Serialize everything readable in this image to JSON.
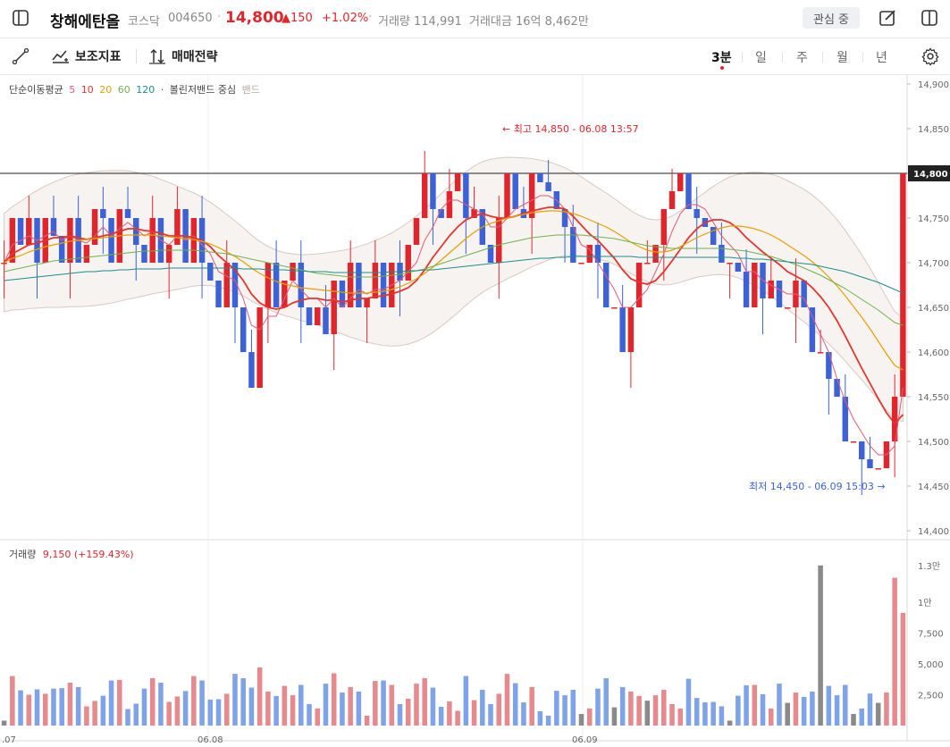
{
  "header": {
    "stock_name": "창해에탄올",
    "market": "코스닥",
    "code": "004650",
    "separator": "·",
    "price": "14,800",
    "change": "▲150",
    "change_pct": "+1.02%",
    "volume_label": "거래량 114,991",
    "amount_label": "거래대금 16억 8,462만",
    "watch_button": "관심 중"
  },
  "toolbar": {
    "indicators_label": "보조지표",
    "strategy_label": "매매전략",
    "periods": [
      "3분",
      "일",
      "주",
      "월",
      "년"
    ],
    "active_period": "3분"
  },
  "legend": {
    "ma_title": "단순이동평균",
    "ma_periods": [
      "5",
      "10",
      "20",
      "60",
      "120"
    ],
    "bullet": "·",
    "bb_title": "볼린저밴드 중심",
    "bb_band": "밴드"
  },
  "colors": {
    "up": "#e0262d",
    "down": "#3c62d6",
    "ma5": "#e35b7a",
    "ma10": "#e5342d",
    "ma20": "#e6a100",
    "ma60": "#6fb24f",
    "ma120": "#1a8f8a"
  },
  "chart_data": {
    "type": "candlestick",
    "price_axis": [
      "14,900",
      "14,850",
      "14,800",
      "14,750",
      "14,700",
      "14,650",
      "14,600",
      "14,550",
      "14,500",
      "14,450",
      "14,400"
    ],
    "current_price_tag": "14,800",
    "high_annotation": "최고 14,850 - 06.08 13:57",
    "low_annotation": "최저 14,450 - 06.09 15:03",
    "x_axis_labels": [
      ".07",
      "06.08",
      "06.09"
    ],
    "ylim": [
      14400,
      14900
    ],
    "candles_close": [
      14700,
      14750,
      14720,
      14750,
      14700,
      14750,
      14730,
      14700,
      14750,
      14700,
      14720,
      14760,
      14750,
      14700,
      14760,
      14750,
      14720,
      14700,
      14750,
      14700,
      14720,
      14760,
      14700,
      14750,
      14700,
      14680,
      14650,
      14700,
      14650,
      14600,
      14560,
      14650,
      14700,
      14650,
      14680,
      14700,
      14650,
      14630,
      14650,
      14620,
      14680,
      14650,
      14700,
      14650,
      14660,
      14700,
      14650,
      14700,
      14680,
      14720,
      14750,
      14800,
      14760,
      14750,
      14780,
      14800,
      14750,
      14760,
      14720,
      14700,
      14750,
      14800,
      14760,
      14750,
      14800,
      14790,
      14780,
      14760,
      14740,
      14700,
      14700,
      14720,
      14700,
      14650,
      14650,
      14600,
      14650,
      14700,
      14700,
      14720,
      14760,
      14780,
      14800,
      14760,
      14750,
      14740,
      14720,
      14700,
      14700,
      14690,
      14650,
      14700,
      14660,
      14680,
      14650,
      14650,
      14680,
      14650,
      14600,
      14600,
      14570,
      14550,
      14500,
      14500,
      14480,
      14470,
      14470,
      14500,
      14550,
      14800
    ],
    "ma_series": [
      {
        "name": "5",
        "values": [
          14700,
          14720,
          14725,
          14730,
          14725,
          14730,
          14735,
          14725,
          14730,
          14725,
          14722,
          14730,
          14740,
          14730,
          14738,
          14745,
          14738,
          14730,
          14735,
          14725,
          14720,
          14730,
          14725,
          14730,
          14720,
          14710,
          14690,
          14685,
          14680,
          14660,
          14630,
          14625,
          14640,
          14640,
          14660,
          14680,
          14670,
          14660,
          14660,
          14650,
          14660,
          14650,
          14660,
          14670,
          14665,
          14670,
          14670,
          14675,
          14680,
          14690,
          14700,
          14725,
          14740,
          14760,
          14770,
          14770,
          14765,
          14760,
          14755,
          14740,
          14740,
          14750,
          14760,
          14765,
          14770,
          14775,
          14775,
          14770,
          14760,
          14740,
          14720,
          14715,
          14700,
          14685,
          14670,
          14650,
          14650,
          14660,
          14670,
          14690,
          14710,
          14735,
          14755,
          14765,
          14765,
          14760,
          14745,
          14730,
          14720,
          14710,
          14690,
          14690,
          14680,
          14675,
          14670,
          14665,
          14665,
          14660,
          14640,
          14620,
          14600,
          14570,
          14545,
          14525,
          14510,
          14495,
          14485,
          14485,
          14495,
          14560
        ]
      },
      {
        "name": "10",
        "values": [
          14700,
          14710,
          14715,
          14720,
          14722,
          14725,
          14728,
          14728,
          14730,
          14728,
          14726,
          14728,
          14730,
          14732,
          14735,
          14738,
          14738,
          14736,
          14735,
          14733,
          14730,
          14730,
          14730,
          14728,
          14725,
          14718,
          14708,
          14700,
          14692,
          14680,
          14665,
          14655,
          14650,
          14648,
          14650,
          14655,
          14658,
          14660,
          14660,
          14658,
          14658,
          14656,
          14658,
          14660,
          14660,
          14662,
          14663,
          14665,
          14668,
          14672,
          14680,
          14692,
          14706,
          14718,
          14730,
          14740,
          14748,
          14752,
          14755,
          14752,
          14750,
          14750,
          14752,
          14755,
          14758,
          14760,
          14762,
          14762,
          14760,
          14752,
          14742,
          14732,
          14725,
          14715,
          14705,
          14692,
          14682,
          14678,
          14676,
          14680,
          14690,
          14702,
          14715,
          14728,
          14738,
          14745,
          14748,
          14748,
          14745,
          14738,
          14728,
          14720,
          14712,
          14705,
          14698,
          14690,
          14685,
          14680,
          14672,
          14662,
          14650,
          14635,
          14618,
          14600,
          14582,
          14565,
          14548,
          14532,
          14520,
          14530
        ]
      },
      {
        "name": "20",
        "values": [
          14700,
          14705,
          14708,
          14712,
          14715,
          14718,
          14720,
          14722,
          14724,
          14725,
          14726,
          14727,
          14728,
          14729,
          14730,
          14731,
          14731,
          14731,
          14731,
          14730,
          14729,
          14728,
          14727,
          14726,
          14724,
          14721,
          14717,
          14712,
          14707,
          14701,
          14694,
          14688,
          14683,
          14679,
          14676,
          14674,
          14672,
          14671,
          14670,
          14669,
          14668,
          14667,
          14666,
          14666,
          14666,
          14667,
          14668,
          14670,
          14673,
          14677,
          14682,
          14688,
          14695,
          14703,
          14711,
          14719,
          14727,
          14734,
          14740,
          14744,
          14747,
          14750,
          14752,
          14754,
          14756,
          14757,
          14758,
          14758,
          14757,
          14755,
          14752,
          14748,
          14744,
          14740,
          14735,
          14729,
          14723,
          14718,
          14714,
          14712,
          14712,
          14714,
          14718,
          14723,
          14728,
          14732,
          14736,
          14739,
          14741,
          14741,
          14740,
          14738,
          14735,
          14731,
          14726,
          14720,
          14714,
          14708,
          14701,
          14693,
          14684,
          14674,
          14663,
          14651,
          14639,
          14626,
          14612,
          14598,
          14585,
          14580
        ]
      },
      {
        "name": "60",
        "values": [
          14690,
          14692,
          14694,
          14696,
          14698,
          14700,
          14702,
          14703,
          14704,
          14705,
          14706,
          14707,
          14708,
          14709,
          14710,
          14711,
          14712,
          14713,
          14713,
          14714,
          14714,
          14714,
          14714,
          14714,
          14713,
          14712,
          14711,
          14710,
          14708,
          14706,
          14704,
          14702,
          14700,
          14698,
          14696,
          14694,
          14692,
          14690,
          14688,
          14687,
          14686,
          14685,
          14684,
          14684,
          14684,
          14684,
          14685,
          14686,
          14687,
          14689,
          14691,
          14693,
          14696,
          14699,
          14702,
          14705,
          14708,
          14711,
          14714,
          14717,
          14720,
          14722,
          14724,
          14726,
          14728,
          14729,
          14730,
          14731,
          14731,
          14731,
          14731,
          14730,
          14729,
          14728,
          14727,
          14725,
          14723,
          14721,
          14719,
          14718,
          14717,
          14716,
          14716,
          14716,
          14716,
          14716,
          14716,
          14716,
          14715,
          14714,
          14713,
          14711,
          14709,
          14707,
          14704,
          14701,
          14698,
          14694,
          14690,
          14686,
          14681,
          14676,
          14671,
          14665,
          14659,
          14653,
          14647,
          14640,
          14633,
          14630
        ]
      },
      {
        "name": "120",
        "values": [
          14680,
          14681,
          14682,
          14683,
          14684,
          14685,
          14686,
          14687,
          14688,
          14689,
          14690,
          14690,
          14691,
          14691,
          14692,
          14692,
          14693,
          14693,
          14693,
          14693,
          14694,
          14694,
          14694,
          14694,
          14694,
          14694,
          14694,
          14694,
          14694,
          14693,
          14693,
          14693,
          14692,
          14692,
          14692,
          14691,
          14691,
          14690,
          14690,
          14690,
          14689,
          14689,
          14689,
          14689,
          14689,
          14689,
          14689,
          14690,
          14690,
          14691,
          14691,
          14692,
          14692,
          14693,
          14694,
          14695,
          14696,
          14697,
          14698,
          14699,
          14700,
          14701,
          14702,
          14703,
          14704,
          14705,
          14705,
          14706,
          14706,
          14707,
          14707,
          14707,
          14707,
          14707,
          14707,
          14707,
          14707,
          14706,
          14706,
          14706,
          14706,
          14706,
          14706,
          14706,
          14706,
          14706,
          14706,
          14706,
          14706,
          14705,
          14705,
          14704,
          14704,
          14703,
          14702,
          14701,
          14700,
          14699,
          14698,
          14696,
          14694,
          14692,
          14690,
          14687,
          14684,
          14681,
          14678,
          14674,
          14670,
          14666
        ]
      }
    ],
    "volume_axis": [
      "1.3만",
      "1만",
      "7,500",
      "5,000",
      "2,500"
    ],
    "volume_ylim": [
      0,
      14000
    ],
    "volume_legend_label": "거래량",
    "volume_legend_value": "9,150 (+159.43%)"
  }
}
